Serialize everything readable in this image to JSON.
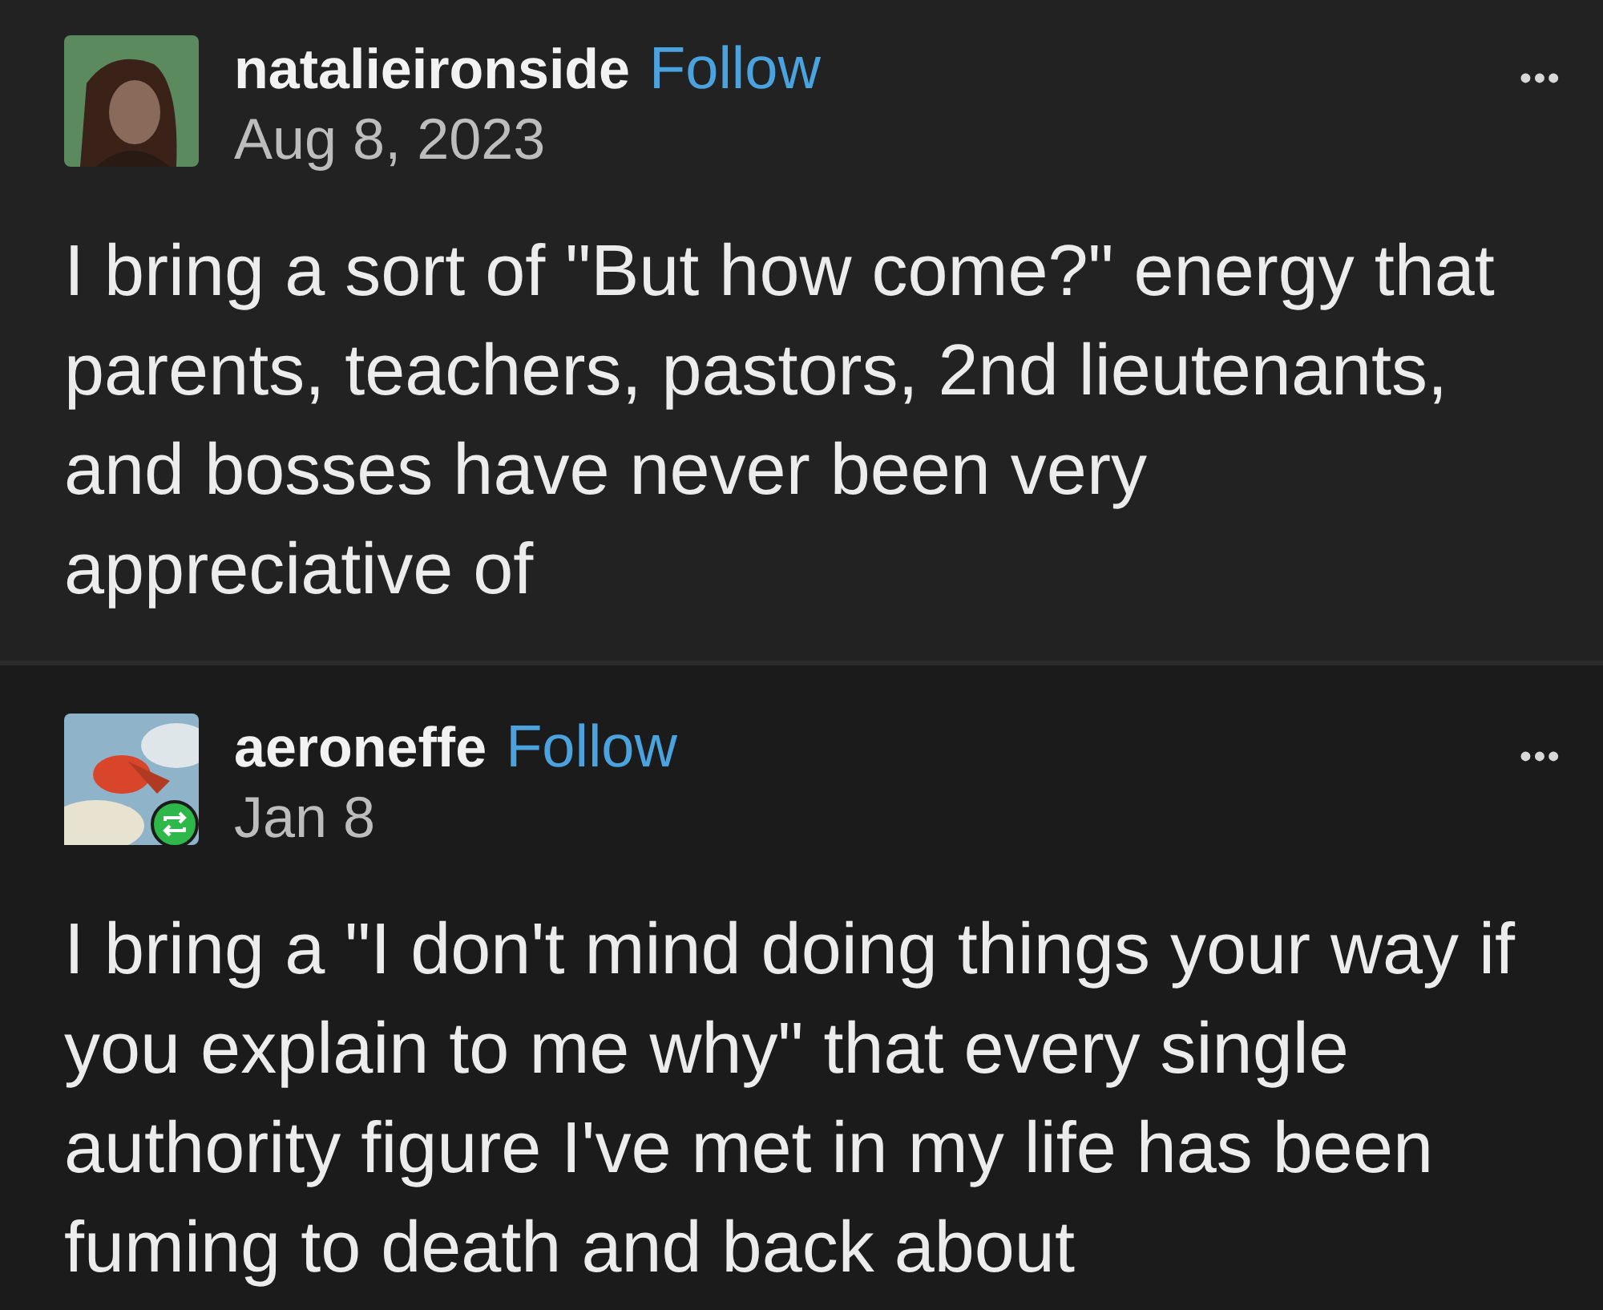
{
  "posts": [
    {
      "username": "natalieironside",
      "follow": "Follow",
      "date": "Aug 8, 2023",
      "reblogged": false,
      "more": "•••",
      "body": "I bring a sort of \"But how come?\" energy that parents, teachers, pastors, 2nd lieutenants, and bosses have never been very appreciative of"
    },
    {
      "username": "aeroneffe",
      "follow": "Follow",
      "date": "Jan 8",
      "reblogged": true,
      "more": "•••",
      "body": "I bring a \"I don't mind doing things your way if you explain to me why\" that every single authority figure I've met in my life has been fuming to death and back about"
    }
  ]
}
